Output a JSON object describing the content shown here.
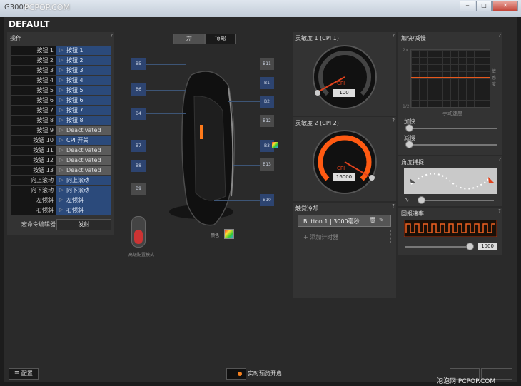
{
  "window": {
    "app_name": "G300S",
    "watermark": "PCPOP.COM",
    "min_label": "‒",
    "max_label": "□",
    "close_label": "✕"
  },
  "profile": {
    "title": "DEFAULT"
  },
  "operations": {
    "header": "操作",
    "rows": [
      {
        "label": "按钮 1",
        "value": "按钮 1",
        "type": "blue"
      },
      {
        "label": "按钮 2",
        "value": "按钮 2",
        "type": "blue"
      },
      {
        "label": "按钮 3",
        "value": "按钮 3",
        "type": "blue"
      },
      {
        "label": "按钮 4",
        "value": "按钮 4",
        "type": "blue"
      },
      {
        "label": "按钮 5",
        "value": "按钮 5",
        "type": "blue"
      },
      {
        "label": "按钮 6",
        "value": "按钮 6",
        "type": "blue"
      },
      {
        "label": "按钮 7",
        "value": "按钮 7",
        "type": "blue"
      },
      {
        "label": "按钮 8",
        "value": "按钮 8",
        "type": "blue"
      },
      {
        "label": "按钮 9",
        "value": "Deactivated",
        "type": "gray"
      },
      {
        "label": "按钮 10",
        "value": "CPI 开关",
        "type": "blue"
      },
      {
        "label": "按钮 11",
        "value": "Deactivated",
        "type": "gray"
      },
      {
        "label": "按钮 12",
        "value": "Deactivated",
        "type": "gray"
      },
      {
        "label": "按钮 13",
        "value": "Deactivated",
        "type": "gray"
      },
      {
        "label": "向上滚动",
        "value": "向上滚动",
        "type": "blue"
      },
      {
        "label": "向下滚动",
        "value": "向下滚动",
        "type": "blue"
      },
      {
        "label": "左倾斜",
        "value": "左倾斜",
        "type": "blue"
      },
      {
        "label": "右倾斜",
        "value": "右倾斜",
        "type": "blue"
      }
    ],
    "macro_label": "宏命令编辑器",
    "macro_button": "发射"
  },
  "view_toggle": {
    "left": "左",
    "top": "顶部"
  },
  "mouse_buttons": {
    "B5": "B5",
    "B6": "B6",
    "B4": "B4",
    "B7": "B7",
    "B8": "B8",
    "B9": "B9",
    "B11": "B11",
    "B1": "B1",
    "B2": "B2",
    "B12": "B12",
    "B3": "B3",
    "B13": "B13",
    "B10": "B10"
  },
  "switch_label": "高级配置模式",
  "color_label": "颜色",
  "cpi1": {
    "title": "灵敏度 1 (CPI 1)",
    "gauge_label": "CPI",
    "value": "100",
    "level": 0.02
  },
  "cpi2": {
    "title": "灵敏度 2 (CPI 2)",
    "gauge_label": "CPI",
    "value": "16000",
    "level": 1.0
  },
  "accel": {
    "title": "加快/减慢",
    "y_top": "2×",
    "y_bottom": "1/2",
    "x_label": "手动速度",
    "side_label": "敏感度",
    "faster": "加快",
    "slower": "减慢"
  },
  "angle": {
    "title": "角度捕捉"
  },
  "polling": {
    "title": "回报速率",
    "value": "1000"
  },
  "debounce": {
    "title": "触觉冷却",
    "item": "Button 1 | 3000毫秒",
    "add": "添加计时器"
  },
  "footer": {
    "settings": "配置",
    "live_preview": "实时预览开启",
    "btn_a": "",
    "btn_b": ""
  },
  "corner_watermark": "泡泡网 PCPOP.COM"
}
